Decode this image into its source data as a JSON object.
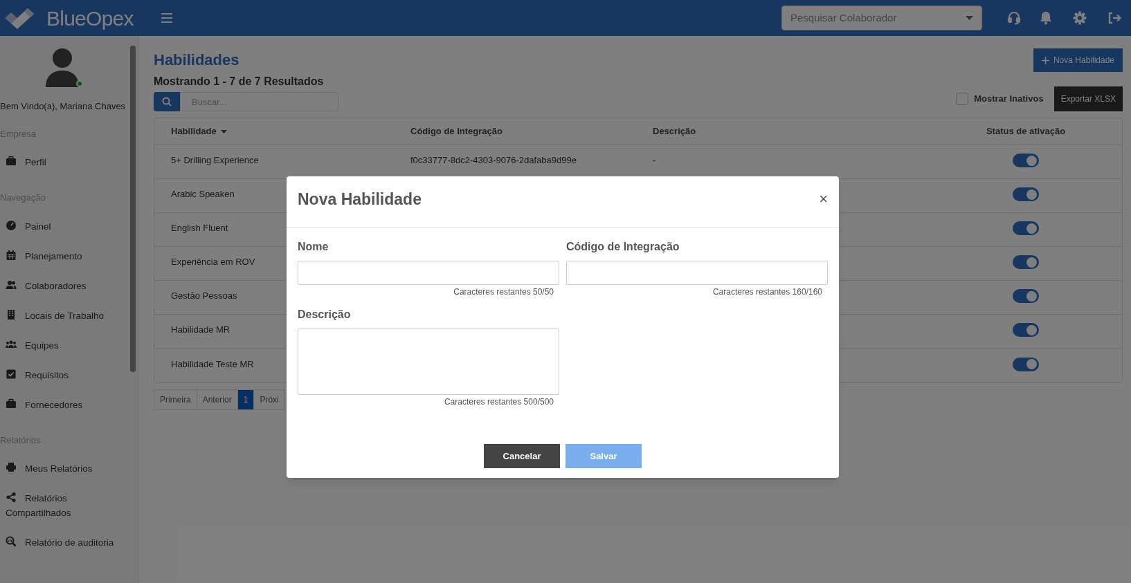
{
  "header": {
    "logo": "BlueOpex",
    "search_placeholder": "Pesquisar Colaborador"
  },
  "sidebar": {
    "greeting": "Bem Vindo(a), Mariana Chaves",
    "online": true,
    "sections": [
      {
        "title": "Empresa",
        "items": [
          {
            "label": "Perfil",
            "kind": "briefcase"
          }
        ]
      },
      {
        "title": "Navegação",
        "items": [
          {
            "label": "Painel",
            "kind": "gauge"
          },
          {
            "label": "Planejamento",
            "kind": "calendar"
          },
          {
            "label": "Colaboradores",
            "kind": "users"
          },
          {
            "label": "Locais de Trabalho",
            "kind": "building"
          },
          {
            "label": "Equipes",
            "kind": "team"
          },
          {
            "label": "Requisitos",
            "kind": "check"
          },
          {
            "label": "Fornecedores",
            "kind": "briefcase"
          }
        ]
      },
      {
        "title": "Relatórios",
        "items": [
          {
            "label": "Meus Relatórios",
            "kind": "printer"
          },
          {
            "label": "Relatórios Compartilhados",
            "kind": "share"
          },
          {
            "label": "Relatório de auditoria",
            "kind": "audit"
          }
        ]
      }
    ]
  },
  "page": {
    "title": "Habilidades",
    "new_button": "Nova Habilidade",
    "results": "Mostrando 1 - 7 de 7 Resultados",
    "search_placeholder": "Buscar...",
    "show_inactive": {
      "label": "Mostrar Inativos",
      "checked": false
    },
    "export_button": "Exportar XLSX"
  },
  "table": {
    "columns": [
      "Habilidade",
      "Código de Integração",
      "Descrição",
      "Status de ativação"
    ],
    "rows": [
      {
        "name": "5+ Drilling Experience",
        "code": "f0c33777-8dc2-4303-9076-2dafaba9d99e",
        "description": "-",
        "on": true
      },
      {
        "name": "Arabic Speaken",
        "on": true
      },
      {
        "name": "English Fluent",
        "on": true
      },
      {
        "name": "Experiência em ROV",
        "on": true
      },
      {
        "name": "Gestão Pessoas",
        "on": true
      },
      {
        "name": "Habilidade MR",
        "on": true
      },
      {
        "name": "Habilidade Teste MR",
        "on": true
      }
    ]
  },
  "pagination": [
    {
      "label": "Primeira",
      "selected": false
    },
    {
      "label": "Anterior",
      "selected": false
    },
    {
      "label": "1",
      "selected": true
    },
    {
      "label": "Próxi",
      "selected": false
    }
  ],
  "modal": {
    "title": "Nova Habilidade",
    "close": "×",
    "fields": [
      {
        "label": "Nome",
        "kind": "text",
        "counter": "Caracteres restantes 50/50"
      },
      {
        "label": "Código de Integração",
        "kind": "text",
        "counter": "Caracteres restantes 160/160"
      },
      {
        "label": "Descrição",
        "kind": "textarea",
        "counter": "Caracteres restantes 500/500"
      }
    ],
    "cancel": "Cancelar",
    "save": "Salvar"
  }
}
